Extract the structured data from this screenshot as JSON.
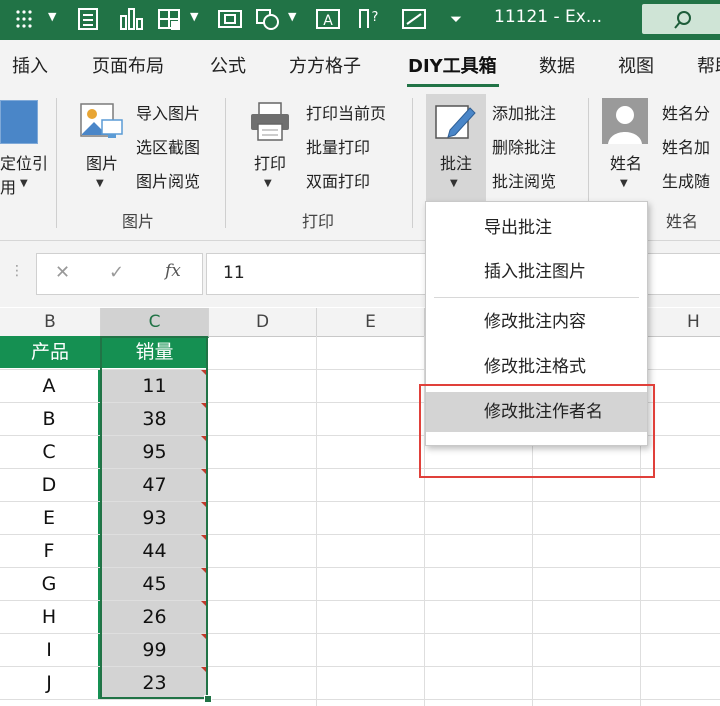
{
  "titlebar": {
    "doc_title": "11121  -  Ex...",
    "search_glyph": "⌕"
  },
  "tabs": [
    {
      "label": "插入",
      "active": false
    },
    {
      "label": "页面布局",
      "active": false
    },
    {
      "label": "公式",
      "active": false
    },
    {
      "label": "方方格子",
      "active": false
    },
    {
      "label": "DIY工具箱",
      "active": true
    },
    {
      "label": "数据",
      "active": false
    },
    {
      "label": "视图",
      "active": false
    },
    {
      "label": "帮助",
      "active": false
    }
  ],
  "ribbon": {
    "left_partial": {
      "line1": "定位引",
      "line2": "用"
    },
    "picture_group": {
      "big_button": "图片",
      "items": [
        "导入图片",
        "选区截图",
        "图片阅览"
      ],
      "group_label": "图片"
    },
    "print_group": {
      "big_button": "打印",
      "items": [
        "打印当前页",
        "批量打印",
        "双面打印"
      ],
      "group_label": "打印"
    },
    "comment_group": {
      "big_button": "批注",
      "items": [
        "添加批注",
        "删除批注",
        "批注阅览"
      ]
    },
    "name_group": {
      "big_button": "姓名",
      "items": [
        "姓名分",
        "姓名加",
        "生成随"
      ],
      "group_label": "姓名"
    }
  },
  "formula_bar": {
    "cancel": "✕",
    "enter": "✓",
    "fx": "fx",
    "value": "11"
  },
  "grid": {
    "columns": [
      "B",
      "C",
      "D",
      "E",
      "H"
    ],
    "selected_column": "C",
    "header_row": {
      "b": "产品",
      "c": "销量"
    },
    "rows": [
      {
        "b": "A",
        "c": "11"
      },
      {
        "b": "B",
        "c": "38"
      },
      {
        "b": "C",
        "c": "95"
      },
      {
        "b": "D",
        "c": "47"
      },
      {
        "b": "E",
        "c": "93"
      },
      {
        "b": "F",
        "c": "44"
      },
      {
        "b": "G",
        "c": "45"
      },
      {
        "b": "H",
        "c": "26"
      },
      {
        "b": "I",
        "c": "99"
      },
      {
        "b": "J",
        "c": "23"
      }
    ]
  },
  "dropdown_menu": {
    "items": [
      "导出批注",
      "插入批注图片",
      "修改批注内容",
      "修改批注格式",
      "修改批注作者名"
    ],
    "hovered_index": 4
  },
  "colors": {
    "excel_green": "#217346",
    "table_header_green": "#159052",
    "highlight_red": "#e0403a"
  }
}
